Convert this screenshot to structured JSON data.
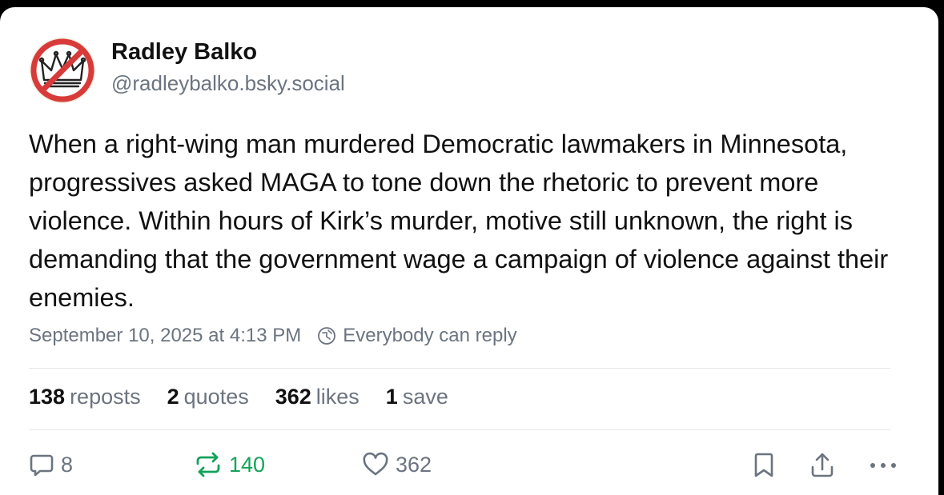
{
  "author": {
    "display_name": "Radley Balko",
    "handle": "@radleybalko.bsky.social",
    "avatar_icon": "crossed-out-crown-avatar-icon"
  },
  "post": {
    "text": "When a right-wing man murdered Democratic lawmakers in Minnesota, progressives asked MAGA to tone down the rhetoric to prevent more violence. Within hours of Kirk’s murder, motive still unknown, the right is demanding that the government wage a campaign of violence against their enemies.",
    "timestamp": "September 10, 2025 at 4:13 PM",
    "reply_setting": "Everybody can reply",
    "reply_setting_icon": "globe-icon"
  },
  "stats": {
    "reposts_count": "138",
    "reposts_label": "reposts",
    "quotes_count": "2",
    "quotes_label": "quotes",
    "likes_count": "362",
    "likes_label": "likes",
    "saves_count": "1",
    "saves_label": "save"
  },
  "actions": {
    "reply_count": "8",
    "repost_count": "140",
    "like_count": "362",
    "reply_icon": "speech-bubble-icon",
    "repost_icon": "repost-icon",
    "like_icon": "heart-icon",
    "bookmark_icon": "bookmark-icon",
    "share_icon": "share-icon",
    "more_icon": "ellipsis-icon"
  },
  "colors": {
    "text": "#111111",
    "muted": "#6b7480",
    "repost_active": "#14a35a",
    "avatar_ring": "#d83a3a",
    "divider": "#e3e6ea"
  }
}
